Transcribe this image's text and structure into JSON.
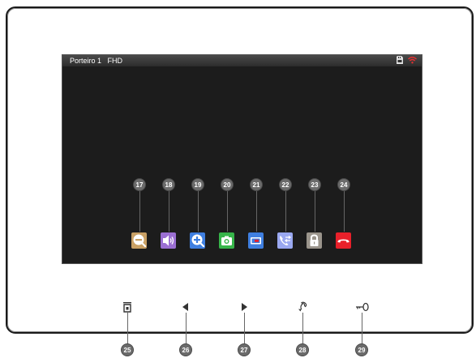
{
  "status_bar": {
    "title": "Porteiro 1   FHD",
    "icons": [
      "sd-card-icon",
      "wifi-icon"
    ]
  },
  "controls": [
    {
      "number": "17",
      "name": "zoom-out-button",
      "icon": "zoom-out-icon",
      "color": "#c9a064"
    },
    {
      "number": "18",
      "name": "volume-button",
      "icon": "speaker-icon",
      "color": "#9b6fd3"
    },
    {
      "number": "19",
      "name": "zoom-in-button",
      "icon": "zoom-in-icon",
      "color": "#3f7fe0"
    },
    {
      "number": "20",
      "name": "snapshot-button",
      "icon": "camera-icon",
      "color": "#37b54a"
    },
    {
      "number": "21",
      "name": "record-button",
      "icon": "record-icon",
      "color": "#3f7fe0"
    },
    {
      "number": "22",
      "name": "transfer-call-button",
      "icon": "call-transfer-icon",
      "color": "#9aa8f0"
    },
    {
      "number": "23",
      "name": "unlock-button",
      "icon": "lock-icon",
      "color": "#9b958c"
    },
    {
      "number": "24",
      "name": "hang-up-button",
      "icon": "hang-up-icon",
      "color": "#e8202a"
    }
  ],
  "hardware_buttons": [
    {
      "number": "25",
      "name": "home-button",
      "icon": "home-icon"
    },
    {
      "number": "26",
      "name": "left-button",
      "icon": "left-arrow-icon"
    },
    {
      "number": "27",
      "name": "right-button",
      "icon": "right-arrow-icon"
    },
    {
      "number": "28",
      "name": "talk-button",
      "icon": "handset-icon"
    },
    {
      "number": "29",
      "name": "unlock-key-button",
      "icon": "key-icon"
    }
  ]
}
